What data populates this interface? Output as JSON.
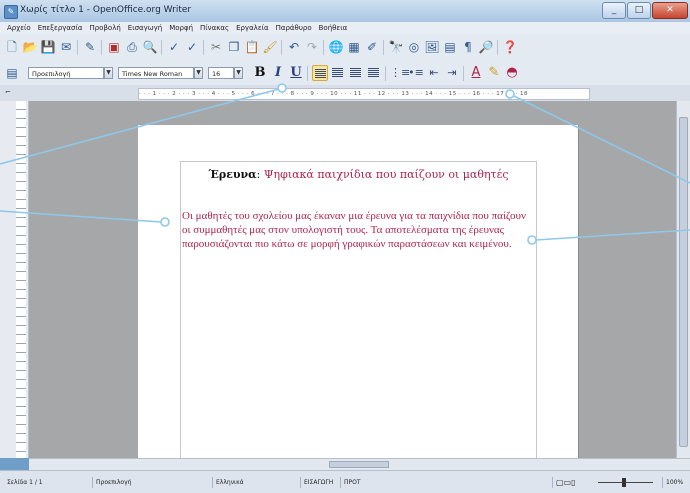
{
  "window": {
    "title": "Χωρίς τίτλο 1 - OpenOffice.org Writer",
    "buttons": {
      "minimize": "_",
      "maximize": "□",
      "close": "✕"
    }
  },
  "menubar": [
    "Αρχείο",
    "Επεξεργασία",
    "Προβολή",
    "Εισαγωγή",
    "Μορφή",
    "Πίνακας",
    "Εργαλεία",
    "Παράθυρο",
    "Βοήθεια"
  ],
  "formatting": {
    "style": "Προεπιλογή",
    "font": "Times New Roman",
    "size": "16",
    "bold": "B",
    "italic": "I",
    "underline": "U"
  },
  "ruler": "· · · 1 · · · 2 · · · 3 · · · 4 · · · 5 · · · 6 · · · 7 · · · 8 · · · 9 · · · 10 · · · 11 · · · 12 · · · 13 · · · 14 · · · 15 · · · 16 · · · 17 · · · 18",
  "document": {
    "title_bold": "Έρευνα",
    "title_colon": ":",
    "title_rest": "Ψηφιακά παιχνίδια που παίζουν οι μαθητές",
    "body": "Οι μαθητές του σχολείου μας έκαναν μια έρευνα για τα παιχνίδια που παίζουν οι συμμαθητές μας στον υπολογιστή τους. Τα αποτελέσματα της έρευνας παρουσιάζονται πιο κάτω σε μορφή γραφικών παραστάσεων και κειμένου."
  },
  "statusbar": {
    "page": "Σελίδα 1 / 1",
    "style": "Προεπιλογή",
    "language": "Ελληνικά",
    "mode": "ΕΙΣΑΓΩΓΗ",
    "selection": "ΠΡΟΤ",
    "zoom": "100%"
  },
  "colors": {
    "accent_text": "#b0224a",
    "callout_line": "#8ec8ea"
  }
}
